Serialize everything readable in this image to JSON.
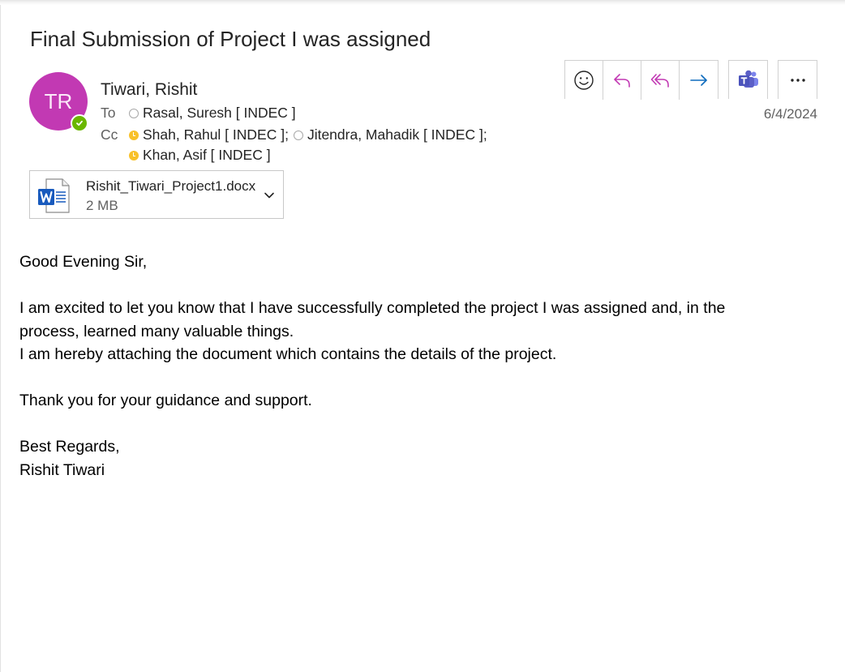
{
  "subject": "Final Submission of Project I was assigned",
  "sender": {
    "initials": "TR",
    "name": "Tiwari, Rishit",
    "avatar_color": "#c239b3",
    "presence": "available",
    "presence_color": "#6bb700"
  },
  "to": {
    "label": "To",
    "recipients": [
      {
        "name": "Rasal, Suresh [ INDEC ]",
        "status": "offline"
      }
    ]
  },
  "cc": {
    "label": "Cc",
    "recipients": [
      {
        "name": "Shah, Rahul [ INDEC ];",
        "status": "away"
      },
      {
        "name": "Jitendra, Mahadik [ INDEC ];",
        "status": "offline"
      },
      {
        "name": "Khan, Asif [ INDEC ]",
        "status": "away"
      }
    ]
  },
  "date": "6/4/2024",
  "toolbar": {
    "buttons": [
      {
        "icon": "emoji-smile-icon"
      },
      {
        "icon": "reply-icon"
      },
      {
        "icon": "reply-all-icon"
      },
      {
        "icon": "forward-icon"
      },
      {
        "icon": "teams-icon"
      },
      {
        "icon": "more-icon"
      }
    ],
    "accent": "#c239b3",
    "forward_color": "#0f6cbd",
    "teams_color": "#5b5fc7"
  },
  "attachment": {
    "name": "Rishit_Tiwari_Project1.docx",
    "size": "2 MB",
    "icon": "word-doc-icon",
    "icon_color": "#185abd"
  },
  "body": {
    "greeting": "Good Evening Sir,",
    "paragraph1_line1": "I am excited to let you know that I have successfully completed the project I was assigned and, in the",
    "paragraph1_line2": "process, learned many valuable things.",
    "paragraph1_line3": "I am hereby attaching the document which contains the details of the project.",
    "thanks": "Thank you for your guidance and support.",
    "closing": "Best Regards,",
    "signature": "Rishit Tiwari"
  }
}
